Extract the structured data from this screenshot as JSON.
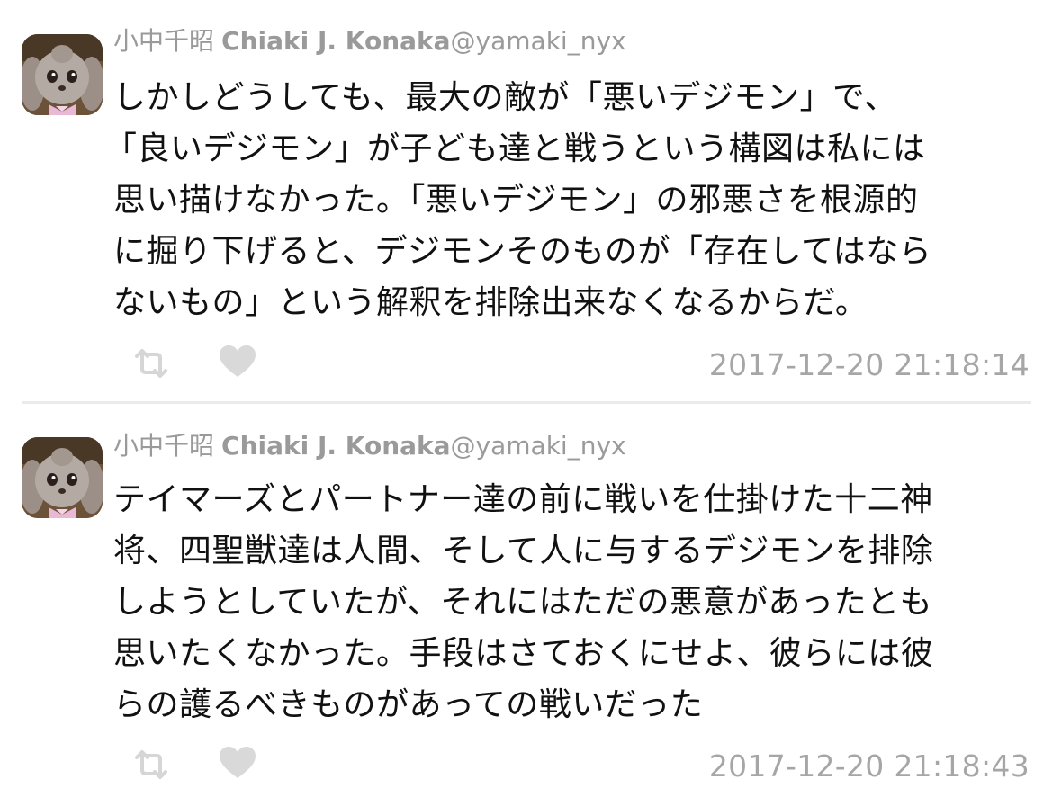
{
  "tweets": [
    {
      "author": {
        "jp_name": "小中千昭",
        "en_name": "Chiaki J. Konaka",
        "handle": "@yamaki_nyx"
      },
      "lines": [
        "しかしどうしても、最大の敵が「悪いデジモン」で、",
        "「良いデジモン」が子ども達と戦うという構図は私には",
        "思い描けなかった。「悪いデジモン」の邪悪さを根源的",
        "に掘り下げると、デジモンそのものが「存在してはなら",
        "ないもの」という解釈を排除出来なくなるからだ。"
      ],
      "timestamp": "2017-12-20 21:18:14"
    },
    {
      "author": {
        "jp_name": "小中千昭",
        "en_name": "Chiaki J. Konaka",
        "handle": "@yamaki_nyx"
      },
      "lines": [
        "テイマーズとパートナー達の前に戦いを仕掛けた十二神",
        "将、四聖獣達は人間、そして人に与するデジモンを排除",
        "しようとしていたが、それにはただの悪意があったとも",
        "思いたくなかった。手段はさておくにせよ、彼らには彼",
        "らの護るべきものがあっての戦いだった"
      ],
      "timestamp": "2017-12-20 21:18:43"
    }
  ],
  "icons": {
    "retweet": "retweet-icon",
    "like": "heart-icon",
    "avatar": "avatar-image"
  },
  "colors": {
    "meta_text": "#9a9a9a",
    "body_text": "#111111",
    "icon": "#d6d6d6",
    "divider": "#ebebeb"
  }
}
